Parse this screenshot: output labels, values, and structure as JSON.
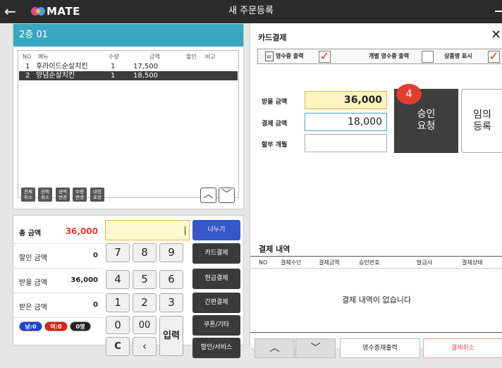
{
  "app": {
    "name": "MATE",
    "window_title": "새 주문등록"
  },
  "table": {
    "name": "2층 01"
  },
  "order_list": {
    "headers": {
      "no": "NO",
      "menu": "메뉴",
      "qty": "수량",
      "amount": "금액",
      "discount": "할인",
      "note": "비고"
    },
    "rows": [
      {
        "no": "1",
        "menu": "후라이드순살치킨",
        "qty": "1",
        "amount": "17,500",
        "selected": false
      },
      {
        "no": "2",
        "menu": "양념순살치킨",
        "qty": "1",
        "amount": "18,500",
        "selected": true
      }
    ]
  },
  "order_buttons": {
    "cancel_all": "전체\n취소",
    "cancel_sel": "선택\n취소",
    "change_price": "금액\n변경",
    "change_qty": "수량\n변경",
    "dine_pack": "내점\n포장"
  },
  "summary": {
    "total_label": "총 금액",
    "total_value": "36,000",
    "discount_label": "할인 금액",
    "discount_value": "0",
    "receivable_label": "받을 금액",
    "receivable_value": "36,000",
    "received_label": "받은 금액",
    "received_value": "0"
  },
  "badges": {
    "male": "남:0",
    "female": "여:0",
    "people": "0명"
  },
  "keypad": {
    "k7": "7",
    "k8": "8",
    "k9": "9",
    "k4": "4",
    "k5": "5",
    "k6": "6",
    "k1": "1",
    "k2": "2",
    "k3": "3",
    "k0": "0",
    "k00": "00",
    "kc": "C",
    "kback": "‹",
    "enter": "입력"
  },
  "function_keys": {
    "split": "나누기",
    "card": "카드결제",
    "cash": "현금결제",
    "simple": "간편결제",
    "coupon": "쿠폰/기타",
    "discount": "할인/서비스"
  },
  "card_payment": {
    "title": "카드결제",
    "receipt_print_label": "영수증 출력",
    "separate_receipt_label": "개별 영수증 출력",
    "show_product_label": "상품명 표시",
    "receivable_label": "받을 금액",
    "receivable_value": "36,000",
    "payment_label": "결제 금액",
    "payment_value": "18,000",
    "installment_label": "할부 개월",
    "installment_value": "",
    "approve_label": "승인\n요청",
    "temp_register_label": "임의\n등록",
    "step_badge": "4"
  },
  "history": {
    "title": "결제 내역",
    "headers": [
      "NO",
      "결제수단",
      "결제금액",
      "승인번호",
      "발급사",
      "결제상태"
    ],
    "empty_text": "결제 내역이 없습니다"
  },
  "footer": {
    "up": "︿",
    "down": "﹀",
    "receipt_reprint": "영수증재출력",
    "cancel_payment": "결제취소"
  },
  "colors": {
    "accent": "#39a7bf",
    "split_button": "#3657c7",
    "red": "#e33d2e",
    "male_badge": "#1a3ee0",
    "female_badge": "#e0201a"
  }
}
